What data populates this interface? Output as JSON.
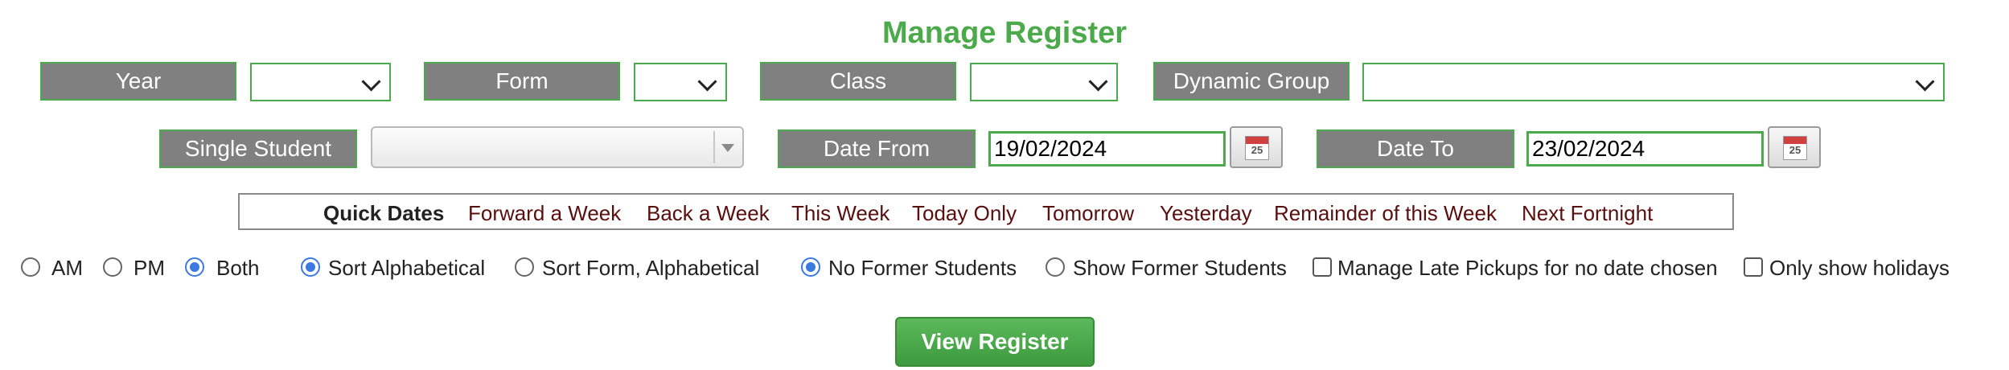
{
  "title": "Manage Register",
  "filters": {
    "year_label": "Year",
    "form_label": "Form",
    "class_label": "Class",
    "dynamic_group_label": "Dynamic Group",
    "single_student_label": "Single Student",
    "date_from_label": "Date From",
    "date_from_value": "19/02/2024",
    "date_to_label": "Date To",
    "date_to_value": "23/02/2024",
    "calendar_day": "25"
  },
  "quick_dates": {
    "heading": "Quick Dates",
    "links": [
      "Forward a Week",
      "Back a Week",
      "This Week",
      "Today Only",
      "Tomorrow",
      "Yesterday",
      "Remainder of this Week",
      "Next Fortnight"
    ]
  },
  "options": {
    "am": "AM",
    "pm": "PM",
    "both": "Both",
    "sort_alpha": "Sort Alphabetical",
    "sort_form": "Sort Form, Alphabetical",
    "no_former": "No Former Students",
    "show_former": "Show Former Students",
    "late_pickups": "Manage Late Pickups for no date chosen",
    "only_holidays": "Only show holidays",
    "session_selected": "Both",
    "sort_selected": "Sort Alphabetical",
    "former_selected": "No Former Students",
    "late_pickups_checked": false,
    "only_holidays_checked": false
  },
  "view_button": "View Register",
  "colors": {
    "accent_green": "#4caa4c",
    "label_grey": "#808080",
    "link_maroon": "#5a0f0f",
    "radio_blue": "#3b7ae0"
  }
}
